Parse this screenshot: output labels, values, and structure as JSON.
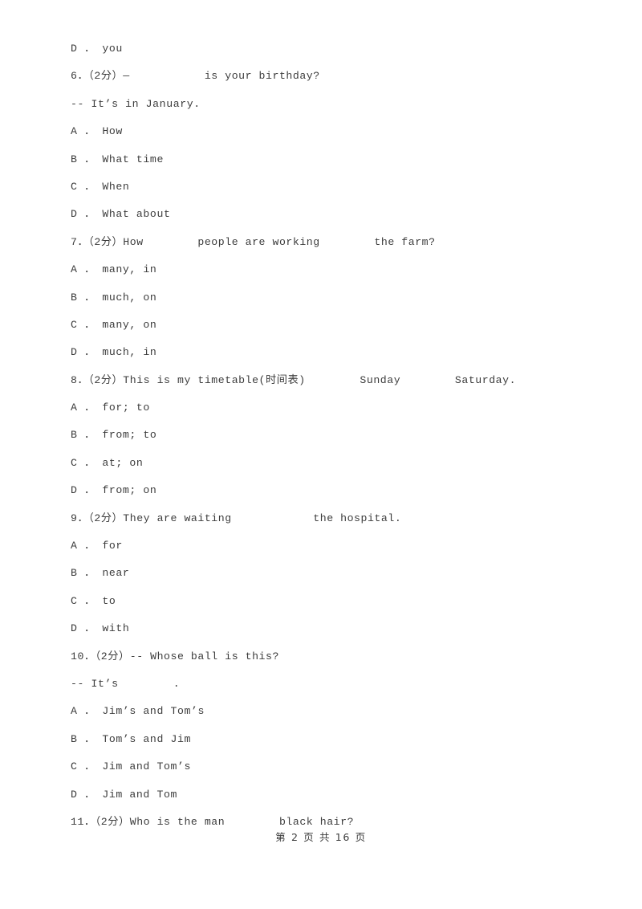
{
  "document": {
    "type": "exam-paper",
    "language": "en-zh",
    "background_color": "#ffffff",
    "text_color": "#3c3c3c"
  },
  "lines": [
    {
      "kind": "option",
      "text": "D ． you"
    },
    {
      "kind": "question",
      "text": "6．（2分）—           is your birthday?"
    },
    {
      "kind": "continuation",
      "text": "-- It’s in January."
    },
    {
      "kind": "option",
      "text": "A ． How"
    },
    {
      "kind": "option",
      "text": "B ． What time"
    },
    {
      "kind": "option",
      "text": "C ． When"
    },
    {
      "kind": "option",
      "text": "D ． What about"
    },
    {
      "kind": "question",
      "text": "7．（2分）How        people are working        the farm?"
    },
    {
      "kind": "option",
      "text": "A ． many, in"
    },
    {
      "kind": "option",
      "text": "B ． much, on"
    },
    {
      "kind": "option",
      "text": "C ． many, on"
    },
    {
      "kind": "option",
      "text": "D ． much, in"
    },
    {
      "kind": "question",
      "text": "8．（2分）This is my timetable(时间表)        Sunday        Saturday."
    },
    {
      "kind": "option",
      "text": "A ． for; to"
    },
    {
      "kind": "option",
      "text": "B ． from; to"
    },
    {
      "kind": "option",
      "text": "C ． at; on"
    },
    {
      "kind": "option",
      "text": "D ． from; on"
    },
    {
      "kind": "question",
      "text": "9．（2分）They are waiting            the hospital."
    },
    {
      "kind": "option",
      "text": "A ． for"
    },
    {
      "kind": "option",
      "text": "B ． near"
    },
    {
      "kind": "option",
      "text": "C ． to"
    },
    {
      "kind": "option",
      "text": "D ． with"
    },
    {
      "kind": "question",
      "text": "10．（2分）-- Whose ball is this?"
    },
    {
      "kind": "continuation",
      "text": "-- It’s        ."
    },
    {
      "kind": "option",
      "text": "A ． Jim’s and Tom’s"
    },
    {
      "kind": "option",
      "text": "B ． Tom’s and Jim"
    },
    {
      "kind": "option",
      "text": "C ． Jim and Tom’s"
    },
    {
      "kind": "option",
      "text": "D ． Jim and Tom"
    },
    {
      "kind": "question",
      "text": "11．（2分）Who is the man        black hair?"
    }
  ],
  "footer": {
    "page_label": "第 2 页 共 16 页",
    "current_page": "2",
    "total_pages": "16"
  }
}
